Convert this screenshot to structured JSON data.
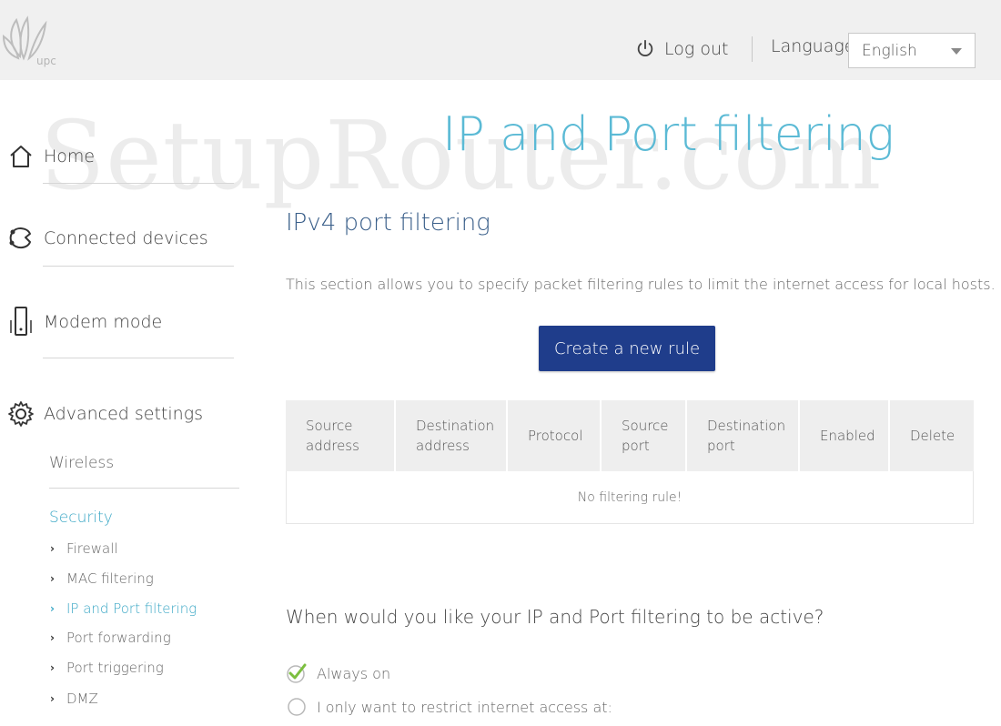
{
  "header": {
    "logo_text": "upc",
    "logout_label": "Log out",
    "language_label": "Language",
    "language_value": "English"
  },
  "watermark": "SetupRouter.com",
  "sidebar": {
    "items": [
      {
        "label": "Home",
        "icon": "home-icon"
      },
      {
        "label": "Connected devices",
        "icon": "devices-icon"
      },
      {
        "label": "Modem mode",
        "icon": "modem-icon"
      },
      {
        "label": "Advanced settings",
        "icon": "gear-icon"
      }
    ],
    "sub_items": [
      {
        "label": "Wireless",
        "active": false
      },
      {
        "label": "Security",
        "active": true
      }
    ],
    "security_items": [
      {
        "label": "Firewall",
        "active": false
      },
      {
        "label": "MAC filtering",
        "active": false
      },
      {
        "label": "IP and Port filtering",
        "active": true
      },
      {
        "label": "Port forwarding",
        "active": false
      },
      {
        "label": "Port triggering",
        "active": false
      },
      {
        "label": "DMZ",
        "active": false
      }
    ]
  },
  "main": {
    "page_title": "IP and Port filtering",
    "section_title": "IPv4 port filtering",
    "description": "This section allows you to specify packet filtering rules to limit the internet access for local hosts.",
    "create_button": "Create a new rule",
    "table": {
      "headers": [
        [
          "Source",
          "address"
        ],
        [
          "Destination",
          "address"
        ],
        [
          "Protocol"
        ],
        [
          "Source",
          "port"
        ],
        [
          "Destination",
          "port"
        ],
        [
          "Enabled"
        ],
        [
          "Delete"
        ]
      ],
      "empty_message": "No filtering rule!"
    },
    "schedule": {
      "question": "When would you like your IP and Port filtering to be active?",
      "options": [
        {
          "label": "Always on",
          "selected": true
        },
        {
          "label": "I only want to restrict internet access at:",
          "selected": false
        }
      ]
    }
  },
  "colors": {
    "accent": "#5bbad5",
    "link_active": "#3aa7c5",
    "button": "#1f3d8b",
    "section_title": "#3a5f8a",
    "check": "#7cbf3f"
  }
}
